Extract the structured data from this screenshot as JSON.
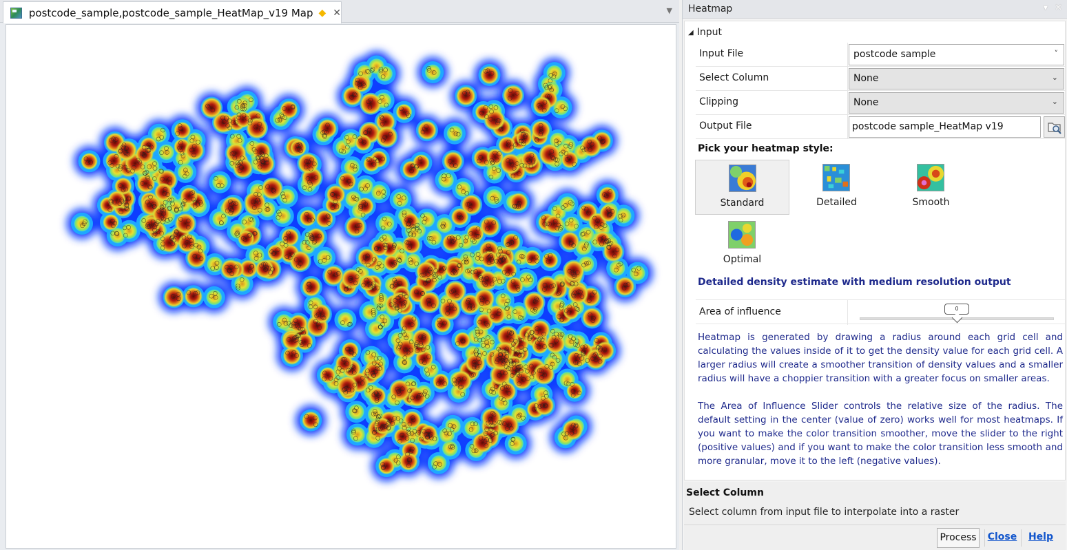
{
  "document_tab": {
    "title": "postcode_sample,postcode_sample_HeatMap_v19 Map",
    "dirty_glyph": "◆",
    "close_glyph": "✕",
    "overflow_glyph": "▼",
    "icon": "map-window-icon"
  },
  "map": {
    "content": "heatmap-raster",
    "palette": [
      "#0a3cff",
      "#14a0ff",
      "#3de0e0",
      "#a8e04a",
      "#f2e02a",
      "#f08a1e",
      "#c81e12",
      "#7a0d08"
    ]
  },
  "panel": {
    "title": "Heatmap",
    "pin_glyph": "▾",
    "close_glyph": "✕",
    "group": {
      "label": "Input",
      "toggle_glyph": "◢"
    },
    "fields": {
      "input_file": {
        "label": "Input File",
        "value": "postcode sample",
        "chevron": "˅"
      },
      "select_column": {
        "label": "Select Column",
        "value": "None",
        "chevron": "⌄"
      },
      "clipping": {
        "label": "Clipping",
        "value": "None",
        "chevron": "⌄"
      },
      "output_file": {
        "label": "Output File",
        "value": "postcode sample_HeatMap v19",
        "browse_icon": "folder-search-icon"
      }
    },
    "style_picker": {
      "label": "Pick your heatmap style:",
      "options": [
        {
          "label": "Standard",
          "selected": true
        },
        {
          "label": "Detailed",
          "selected": false
        },
        {
          "label": "Smooth",
          "selected": false
        },
        {
          "label": "Optimal",
          "selected": false
        }
      ]
    },
    "style_description": "Detailed density estimate with medium resolution output",
    "area_of_influence": {
      "label": "Area of influence",
      "value": "0",
      "position_fraction": 0.5
    },
    "help_paragraphs": [
      "Heatmap is generated by drawing a radius around each grid cell and calculating the values inside of it to get the density value for each grid cell. A larger radius will create a smoother transition of density values and a smaller radius will have a choppier transition with a greater focus on smaller areas.",
      "The Area of Influence Slider controls the relative size of the radius. The default setting in the center (value of zero) works well for most heatmaps. If you want to make the color transition smoother, move the slider to the right (positive values) and if you want to make the color transition less smooth and more granular, move it to the left (negative values)."
    ],
    "info": {
      "title": "Select Column",
      "text": "Select column from input file to interpolate into a raster"
    },
    "buttons": {
      "process": "Process",
      "close": "Close",
      "help": "Help"
    }
  }
}
